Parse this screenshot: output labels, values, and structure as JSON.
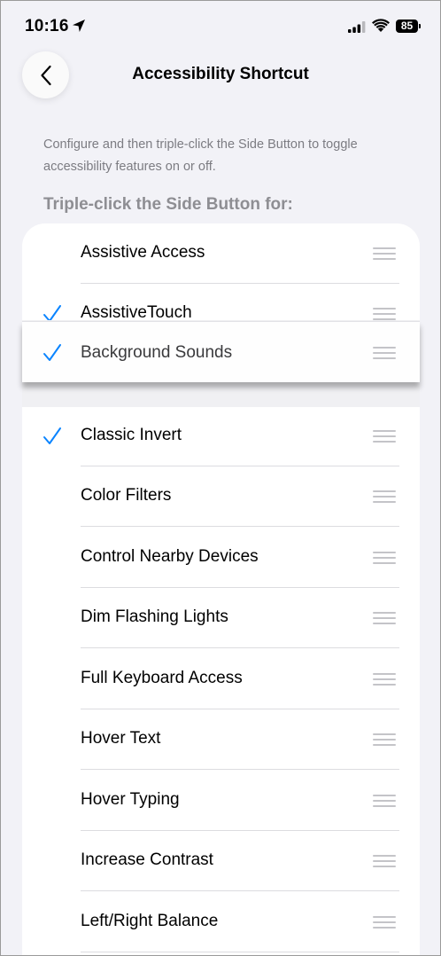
{
  "status_bar": {
    "time": "10:16",
    "battery": "85"
  },
  "nav": {
    "title": "Accessibility Shortcut"
  },
  "description": "Configure and then triple-click the Side Button to toggle accessibility features on or off.",
  "section_header": "Triple-click the Side Button for:",
  "accent_color": "#0a84ff",
  "dragging_item": {
    "label": "Background Sounds",
    "checked": true
  },
  "items": [
    {
      "label": "Assistive Access",
      "checked": false
    },
    {
      "label": "AssistiveTouch",
      "checked": true
    },
    {
      "label": "Classic Invert",
      "checked": true
    },
    {
      "label": "Color Filters",
      "checked": false
    },
    {
      "label": "Control Nearby Devices",
      "checked": false
    },
    {
      "label": "Dim Flashing Lights",
      "checked": false
    },
    {
      "label": "Full Keyboard Access",
      "checked": false
    },
    {
      "label": "Hover Text",
      "checked": false
    },
    {
      "label": "Hover Typing",
      "checked": false
    },
    {
      "label": "Increase Contrast",
      "checked": false
    },
    {
      "label": "Left/Right Balance",
      "checked": false
    }
  ]
}
